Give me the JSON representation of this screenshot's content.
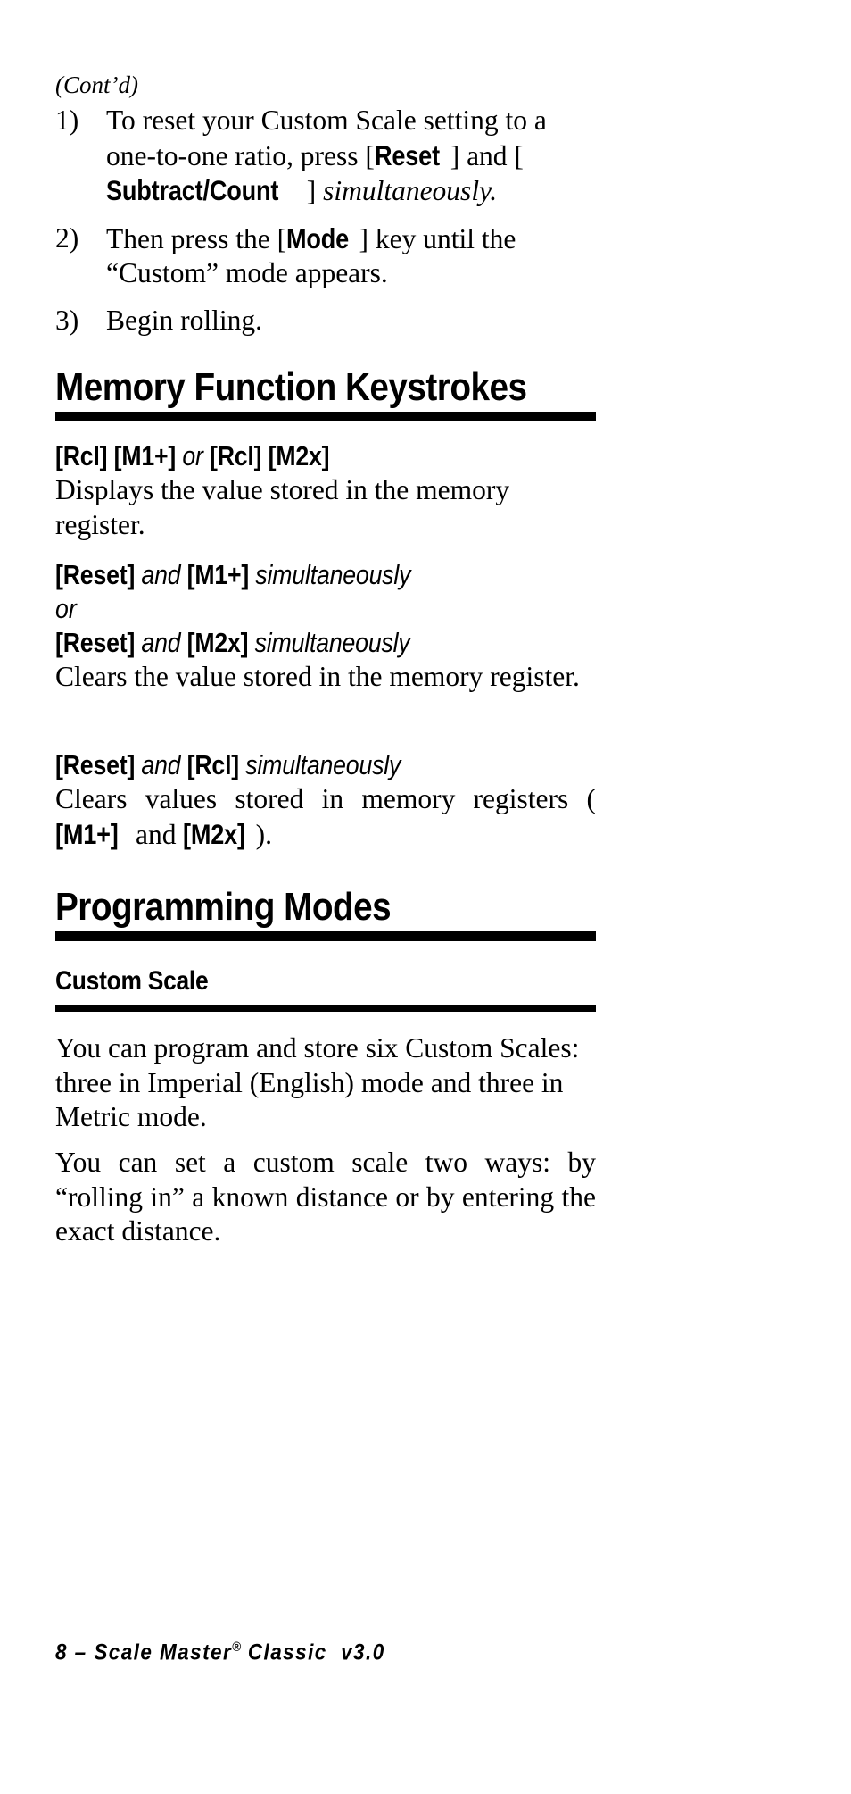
{
  "document": {
    "page_number": "8",
    "product": "Scale Master",
    "trademark": "®",
    "edition": "Classic",
    "version": "v3.0",
    "footer_text": "8 – Scale Master® Classic v3.0"
  },
  "continued_label": "(Cont’d)",
  "steps": [
    {
      "number": "1)",
      "parts": [
        {
          "style": "serif",
          "text": "To reset your Custom Scale setting to a one-to-one ratio, press ["
        },
        {
          "style": "key",
          "text": "Reset"
        },
        {
          "style": "serif",
          "text": "] and ["
        },
        {
          "style": "key",
          "text": "Subtract/Count"
        },
        {
          "style": "serif",
          "text": "] "
        },
        {
          "style": "ital",
          "text": "simultaneously."
        }
      ]
    },
    {
      "number": "2)",
      "parts": [
        {
          "style": "serif",
          "text": "Then press the ["
        },
        {
          "style": "key",
          "text": "Mode"
        },
        {
          "style": "serif",
          "text": "] key until the “Custom” mode appears."
        }
      ]
    },
    {
      "number": "3)",
      "parts": [
        {
          "style": "serif",
          "text": "Begin rolling."
        }
      ]
    }
  ],
  "section_memory": {
    "title": "Memory Function Keystrokes",
    "entries": [
      {
        "keystroke_lines": [
          "[Rcl] [M1+]  or  [Rcl] [M2x]"
        ],
        "description": "Displays the value stored in the memory register.",
        "justified": false
      },
      {
        "keystroke_lines": [
          "[Reset] and [M1+] simultaneously",
          "or",
          "[Reset] and [M2x] simultaneously"
        ],
        "description": "Clears the value stored in the memory register.",
        "justified": false
      },
      {
        "keystroke_lines": [
          "[Reset] and [Rcl] simultaneously"
        ],
        "description": "Clears values stored in memory registers ([M1+] and [M2x]).",
        "justified": true
      }
    ]
  },
  "section_programming": {
    "title": "Programming Modes",
    "subsection_title": "Custom Scale",
    "paragraphs": [
      "You can program and store six Custom Scales: three in Imperial (English) mode and three in Metric mode.",
      "You can set a custom scale two ways: by “rolling in” a known distance or by entering the exact distance."
    ]
  }
}
